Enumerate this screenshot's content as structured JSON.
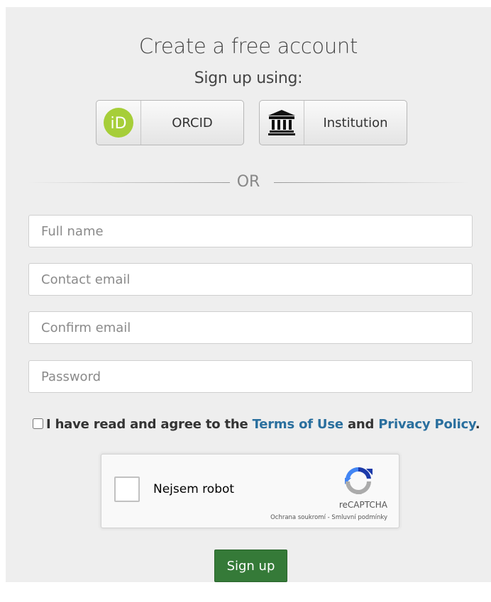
{
  "header": {
    "title": "Create a free account",
    "subtitle": "Sign up using:"
  },
  "sso": {
    "orcid_label": "ORCID",
    "orcid_icon_text": "iD",
    "institution_label": "Institution",
    "orcid_color": "#a6ce39"
  },
  "divider": {
    "text": "OR"
  },
  "form": {
    "full_name_placeholder": "Full name",
    "contact_email_placeholder": "Contact email",
    "confirm_email_placeholder": "Confirm email",
    "password_placeholder": "Password"
  },
  "agreement": {
    "prefix": "I have read and agree to the",
    "terms_link": "Terms of Use",
    "conjunction": "and",
    "privacy_link": "Privacy Policy",
    "suffix": "."
  },
  "captcha": {
    "label": "Nejsem robot",
    "brand": "reCAPTCHA",
    "privacy_link": "Ochrana soukromí",
    "separator": " - ",
    "terms_link": "Smluvní podmínky"
  },
  "submit": {
    "label": "Sign up",
    "color": "#357a38"
  }
}
